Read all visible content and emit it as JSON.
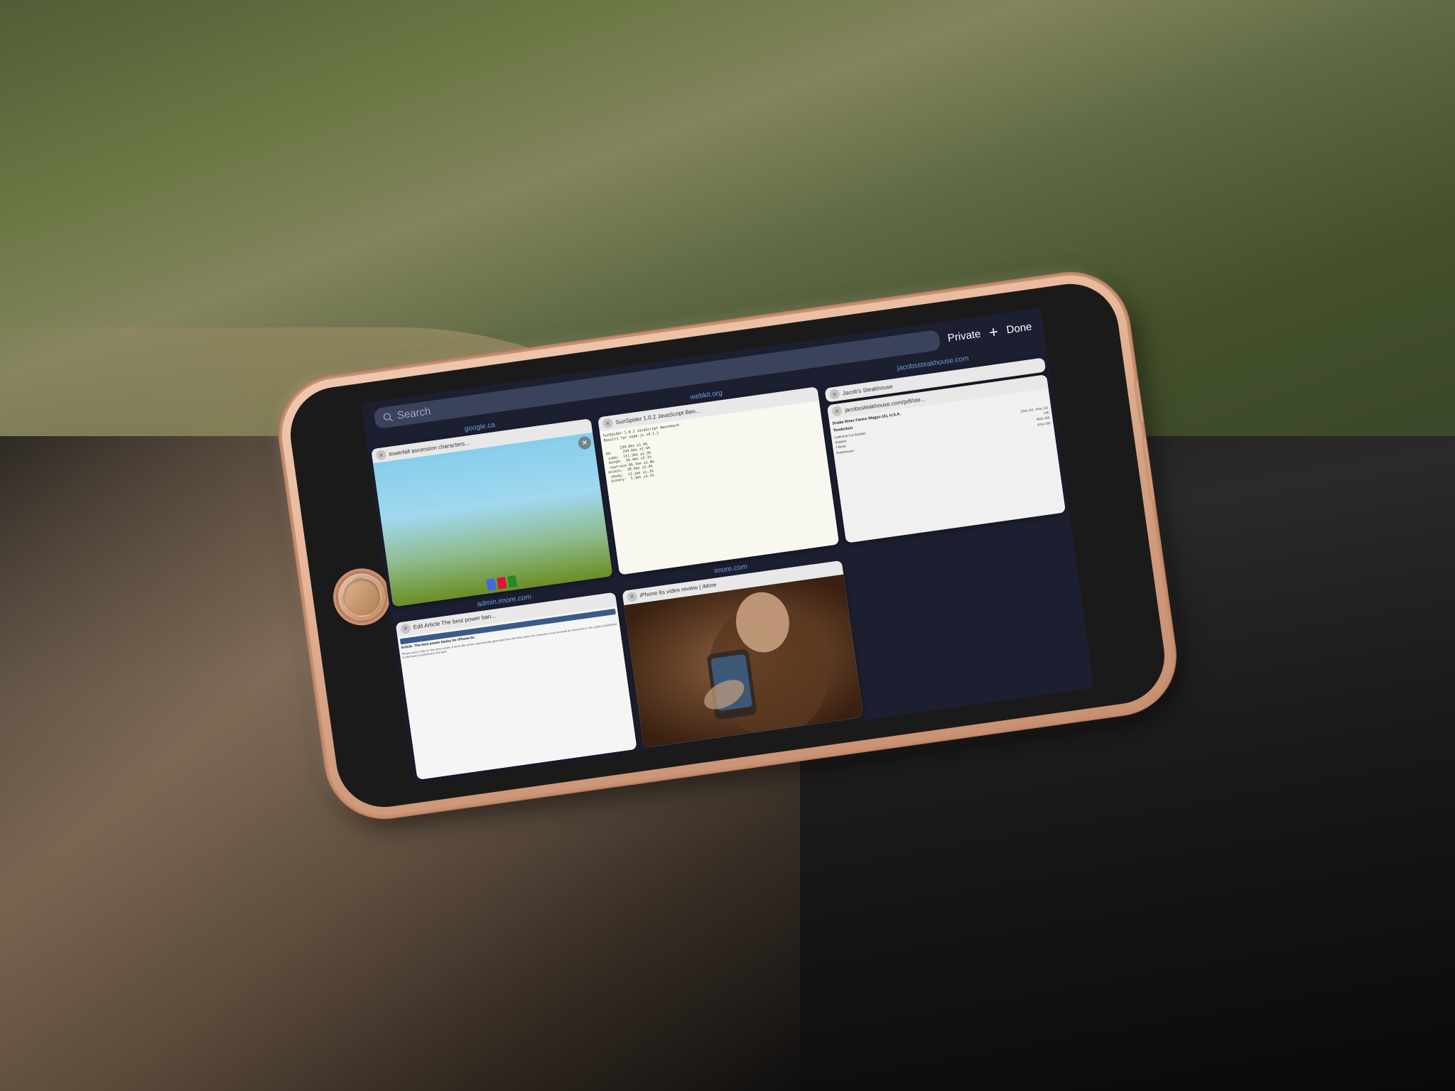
{
  "background": {
    "top_color": "#7a8a5a",
    "bottom_color": "#1a1a1a"
  },
  "phone": {
    "color": "#e8b89a",
    "home_button_color": "#d4a080"
  },
  "safari": {
    "search_placeholder": "Search",
    "private_label": "Private",
    "add_label": "+",
    "done_label": "Done",
    "tabs": [
      {
        "domain": "google.ca",
        "title": "towerfall ascension characters...",
        "url": "google.ca",
        "type": "game"
      },
      {
        "domain": "webkit.org",
        "title": "SunSpider 1.0.2 JavaScript Ben...",
        "url": "webkit.org",
        "type": "benchmark"
      },
      {
        "domain": "jacobssteakhouse.com",
        "title": "Jacob's Steakhouse",
        "url": "jacobssteakhouse.com",
        "type": "restaurant",
        "sub_tab": {
          "title": "jacobssteakhouse.com/pdf/ste...",
          "type": "pdf"
        }
      },
      {
        "domain": "admin.imore.com",
        "title": "Edit Article The best power ban...",
        "url": "admin.imore.com",
        "type": "admin"
      },
      {
        "domain": "imore.com",
        "title": "iPhone 6s video review | iMore",
        "url": "imore.com",
        "type": "video"
      }
    ],
    "steakhouse_menu": {
      "heading": "Snake River Farms Wagyu (A), U.S.A.",
      "subtitle": "Tenderloin",
      "items": [
        {
          "name": "California Cut Striploin",
          "size1": "10oz",
          "price1": "110",
          "size2": "14oz",
          "price2": "132"
        },
        {
          "name": "Striploin",
          "size1": "",
          "price1": "145",
          "size2": "",
          "price2": ""
        },
        {
          "name": "T-Bone",
          "size1": "40oz",
          "price1": "160",
          "size2": "",
          "price2": ""
        },
        {
          "name": "Porterhouse",
          "size1": "42oz",
          "price1": "165",
          "size2": "",
          "price2": ""
        }
      ]
    }
  }
}
